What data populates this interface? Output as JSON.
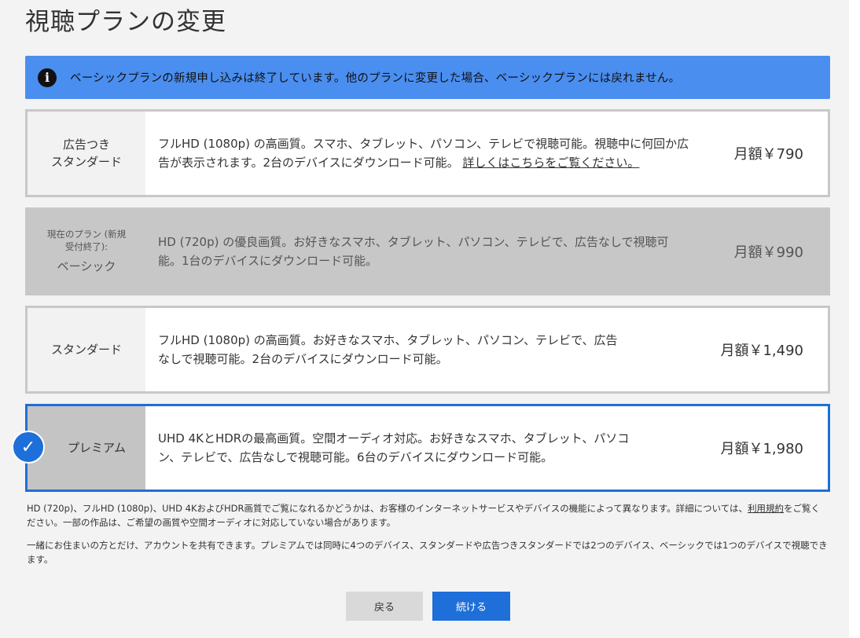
{
  "page": {
    "title": "視聴プランの変更"
  },
  "notice": {
    "text": "ベーシックプランの新規申し込みは終了しています。他のプランに変更した場合、ベーシックプランには戻れません。"
  },
  "plans": [
    {
      "name_line1": "広告つき",
      "name_line2": "スタンダード",
      "description": "フルHD (1080p) の高画質。スマホ、タブレット、パソコン、テレビで視聴可能。視聴中に何回か広告が表示されます。2台のデバイスにダウンロード可能。",
      "link": "詳しくはこちらをご覧ください。",
      "price": "月額￥790"
    },
    {
      "current_label": "現在のプラン (新規受付終了):",
      "name": "ベーシック",
      "description": "HD (720p) の優良画質。お好きなスマホ、タブレット、パソコン、テレビで、広告なしで視聴可能。1台のデバイスにダウンロード可能。",
      "price": "月額￥990"
    },
    {
      "name": "スタンダード",
      "description": "フルHD (1080p) の高画質。お好きなスマホ、タブレット、パソコン、テレビで、広告なしで視聴可能。2台のデバイスにダウンロード可能。",
      "price": "月額￥1,490"
    },
    {
      "name": "プレミアム",
      "description": "UHD 4KとHDRの最高画質。空間オーディオ対応。お好きなスマホ、タブレット、パソコン、テレビで、広告なしで視聴可能。6台のデバイスにダウンロード可能。",
      "price": "月額￥1,980",
      "selected": true
    }
  ],
  "footnotes": {
    "first_text": "HD (720p)、フルHD (1080p)、UHD 4KおよびHDR画質でご覧になれるかどうかは、お客様のインターネットサービスやデバイスの機能によって異なります。詳細については、",
    "terms_link": "利用規約",
    "first_text_end": "をご覧ください。一部の作品は、ご希望の画質や空間オーディオに対応していない場合があります。",
    "second_text": "一緒にお住まいの方とだけ、アカウントを共有できます。プレミアムでは同時に4つのデバイス、スタンダードや広告つきスタンダードでは2つのデバイス、ベーシックでは1つのデバイスで視聴できます。"
  },
  "buttons": {
    "back": "戻る",
    "continue": "続ける"
  },
  "colors": {
    "notice_bg": "#4a8ef0",
    "accent": "#1e6fd9",
    "current_plan_bg": "#c7c7c7"
  },
  "icons": {
    "notice": "info-icon",
    "selected": "checkmark-icon"
  }
}
